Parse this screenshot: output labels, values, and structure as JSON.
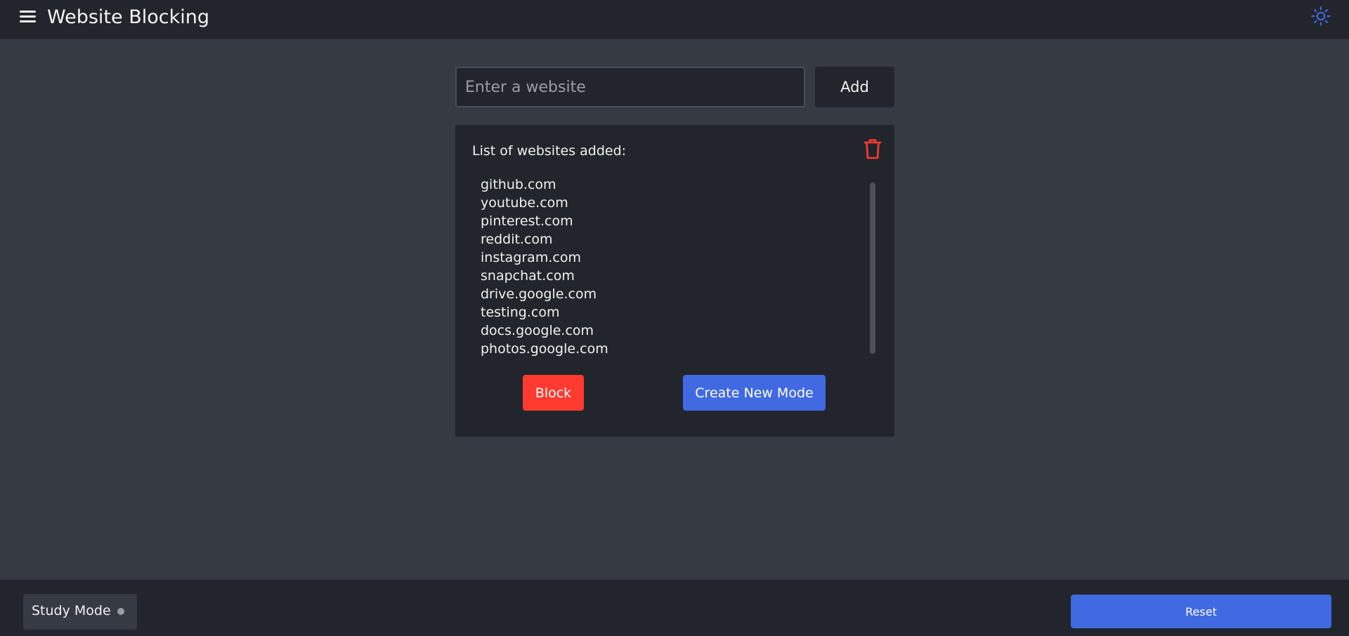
{
  "header": {
    "title": "Website Blocking",
    "menu_icon": "hamburger-menu-icon",
    "theme_icon": "sun-icon",
    "accent_color": "#4169e1"
  },
  "add_form": {
    "input_placeholder": "Enter a website",
    "input_value": "",
    "add_label": "Add"
  },
  "list_card": {
    "heading": "List of websites added:",
    "delete_icon": "trash-icon",
    "delete_color": "#ff3b30",
    "sites": [
      "github.com",
      "youtube.com",
      "pinterest.com",
      "reddit.com",
      "instagram.com",
      "snapchat.com",
      "drive.google.com",
      "testing.com",
      "docs.google.com",
      "photos.google.com"
    ],
    "block_label": "Block",
    "block_color": "#ff3b30",
    "create_mode_label": "Create New Mode",
    "create_mode_color": "#4169e1"
  },
  "footer": {
    "mode_label": "Study Mode",
    "mode_status_icon": "status-dot-icon",
    "reset_label": "Reset",
    "reset_color": "#4169e1"
  }
}
